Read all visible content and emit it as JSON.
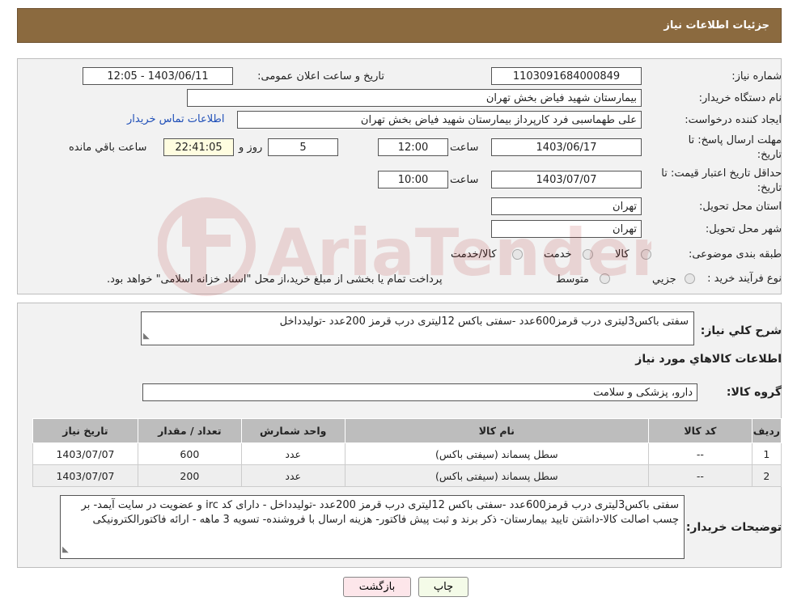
{
  "page_title": "جزئیات اطلاعات نیاز",
  "need_number": {
    "label": "شماره نیاز:",
    "value": "1103091684000849"
  },
  "announce_datetime": {
    "label": "تاریخ و ساعت اعلان عمومی:",
    "value": "1403/06/11 - 12:05"
  },
  "buyer_org": {
    "label": "نام دستگاه خریدار:",
    "value": "بیمارستان شهید فیاض بخش تهران"
  },
  "requester": {
    "label": "ایجاد کننده درخواست:",
    "value": "علی طهماسبی فرد کارپرداز بیمارستان شهید فیاض بخش تهران",
    "contact_link": "اطلاعات تماس خریدار"
  },
  "reply_deadline": {
    "label_line1": "مهلت ارسال پاسخ: تا",
    "label_line2": "تاریخ:",
    "date": "1403/06/17",
    "time_label": "ساعت",
    "time": "12:00",
    "days": "5",
    "days_label": "روز و",
    "remaining": "22:41:05",
    "remaining_label": "ساعت باقي مانده"
  },
  "price_validity": {
    "label_line1": "حداقل تاریخ اعتبار قیمت: تا",
    "label_line2": "تاریخ:",
    "date": "1403/07/07",
    "time_label": "ساعت",
    "time": "10:00"
  },
  "delivery_province": {
    "label": "استان محل تحویل:",
    "value": "تهران"
  },
  "delivery_city": {
    "label": "شهر محل تحویل:",
    "value": "تهران"
  },
  "category": {
    "label": "طبقه بندی موضوعی:",
    "options": [
      "کالا",
      "خدمت",
      "کالا/خدمت"
    ]
  },
  "purchase_process": {
    "label": "نوع فرآیند خرید :",
    "options": [
      "جزيي",
      "متوسط"
    ],
    "note": "پرداخت تمام یا بخشی از مبلغ خرید،از محل \"اسناد خزانه اسلامی\" خواهد بود."
  },
  "general_description": {
    "label": "شرح کلي نياز:",
    "value": "سفتی باکس3لیتری درب قرمز600عدد -سفتی باکس 12لیتری درب قرمز 200عدد -تولیدداخل"
  },
  "goods_section_title": "اطلاعات کالاهاي مورد نياز",
  "goods_group": {
    "label": "گروه کالا:",
    "value": "دارو، پزشکی و سلامت"
  },
  "items_table": {
    "headers": [
      "رديف",
      "کد کالا",
      "نام کالا",
      "واحد شمارش",
      "تعداد / مقدار",
      "تاریخ نیاز"
    ],
    "rows": [
      [
        "1",
        "--",
        "سطل پسماند (سیفتی باکس)",
        "عدد",
        "600",
        "1403/07/07"
      ],
      [
        "2",
        "--",
        "سطل پسماند (سیفتی باکس)",
        "عدد",
        "200",
        "1403/07/07"
      ]
    ]
  },
  "buyer_notes": {
    "label": "توضیحات خریدار:",
    "value": "سفتی باکس3لیتری درب قرمز600عدد -سفتی باکس 12لیتری درب قرمز 200عدد -تولیدداخل - دارای کد irc و عضویت در سایت آیمد- بر چسب اصالت کالا-داشتن تایید بیمارستان- ذکر برند و ثبت پیش فاکتور- هزینه ارسال با فروشنده- تسویه 3 ماهه - ارائه فاکتورالکترونیکی"
  },
  "buttons": {
    "print": "چاپ",
    "back": "بازگشت"
  },
  "watermark_text": "AriaTender.neT"
}
